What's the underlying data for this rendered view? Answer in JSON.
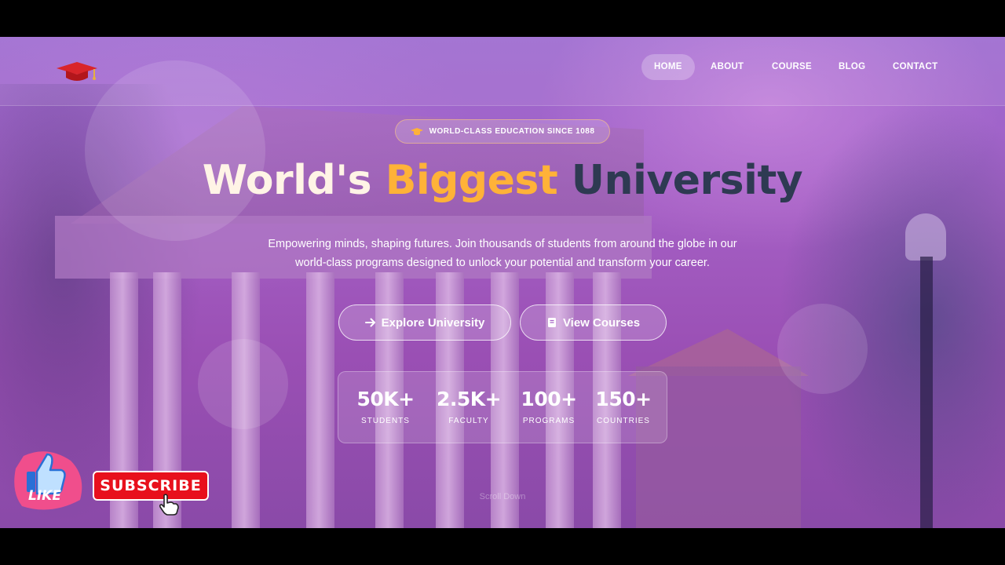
{
  "nav": {
    "items": [
      {
        "label": "HOME",
        "active": true
      },
      {
        "label": "ABOUT",
        "active": false
      },
      {
        "label": "COURSE",
        "active": false
      },
      {
        "label": "BLOG",
        "active": false
      },
      {
        "label": "CONTACT",
        "active": false
      }
    ],
    "logo_icon": "graduation-cap-icon"
  },
  "hero": {
    "badge": "WORLD-CLASS EDUCATION SINCE 1088",
    "badge_icon": "graduation-cap-icon",
    "headline": {
      "word1": "World's",
      "word2": "Biggest",
      "word3": "University"
    },
    "subtitle_line1": "Empowering minds, shaping futures. Join thousands of students from around the globe in our",
    "subtitle_line2": "world-class programs designed to unlock your potential and transform your career.",
    "primary_button": "Explore University",
    "primary_button_icon": "arrow-right-icon",
    "secondary_button": "View Courses",
    "secondary_button_icon": "book-icon"
  },
  "stats": [
    {
      "value": "50K+",
      "label": "STUDENTS"
    },
    {
      "value": "2.5K+",
      "label": "FACULTY"
    },
    {
      "value": "100+",
      "label": "PROGRAMS"
    },
    {
      "value": "150+",
      "label": "COUNTRIES"
    }
  ],
  "scroll_hint": "Scroll Down",
  "overlay": {
    "like_label": "LIKE",
    "subscribe_label": "SUBSCRIBE"
  },
  "colors": {
    "accent_orange": "#ffb238",
    "headline_light": "#fff4e6",
    "headline_dark": "#2e3a52",
    "subscribe_red": "#e8101c"
  }
}
